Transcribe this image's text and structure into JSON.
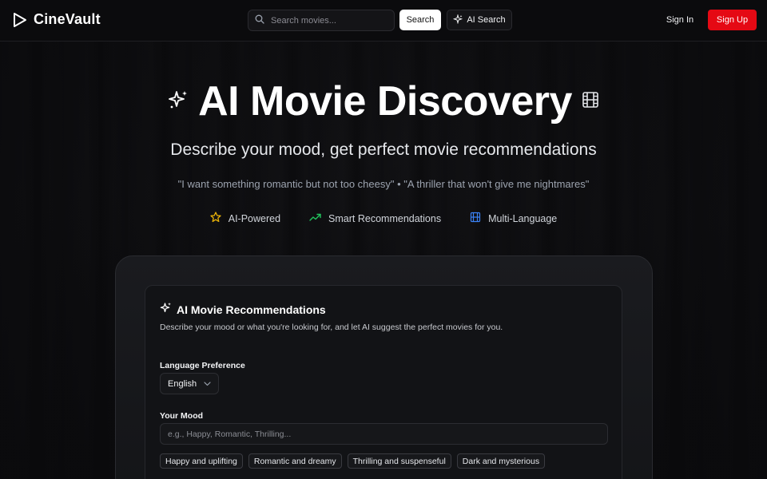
{
  "header": {
    "brand": "CineVault",
    "search_placeholder": "Search movies...",
    "search_button": "Search",
    "ai_search_button": "AI Search",
    "sign_in": "Sign In",
    "sign_up": "Sign Up"
  },
  "hero": {
    "title": "AI Movie Discovery",
    "subtitle": "Describe your mood, get perfect movie recommendations",
    "examples": "\"I want something romantic but not too cheesy\" • \"A thriller that won't give me nightmares\"",
    "features": [
      {
        "label": "AI-Powered",
        "icon": "star-icon",
        "color": "#eab308"
      },
      {
        "label": "Smart Recommendations",
        "icon": "trending-up-icon",
        "color": "#22c55e"
      },
      {
        "label": "Multi-Language",
        "icon": "film-icon",
        "color": "#3b82f6"
      }
    ]
  },
  "card": {
    "title": "AI Movie Recommendations",
    "description": "Describe your mood or what you're looking for, and let AI suggest the perfect movies for you.",
    "language_label": "Language Preference",
    "language_value": "English",
    "mood_label": "Your Mood",
    "mood_placeholder": "e.g., Happy, Romantic, Thrilling...",
    "chips": [
      "Happy and uplifting",
      "Romantic and dreamy",
      "Thrilling and suspenseful",
      "Dark and mysterious"
    ]
  },
  "colors": {
    "accent": "#e50914",
    "background": "#0b0b0d"
  }
}
